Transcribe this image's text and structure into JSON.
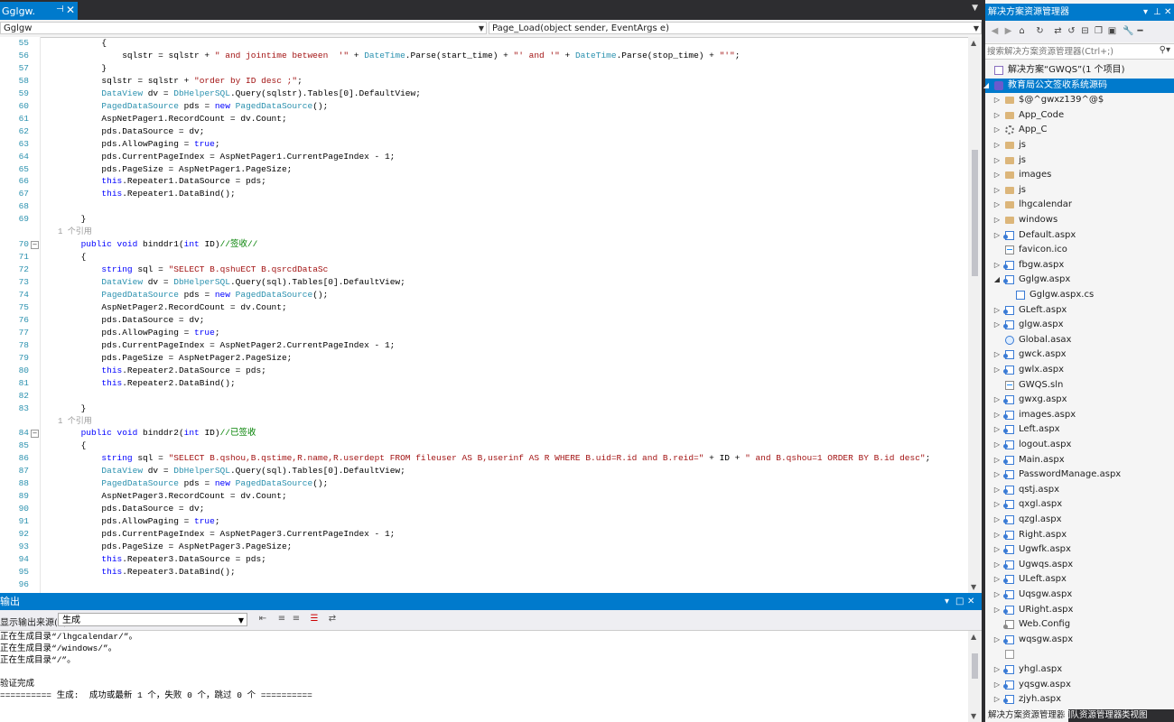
{
  "editor": {
    "tab": {
      "title": "Gglgw.",
      "pin": "⊣",
      "close": "✕"
    },
    "nav": {
      "left": "Gglgw",
      "right": "Page_Load(object sender, EventArgs e)"
    },
    "lines": [
      {
        "n": "55",
        "segs": [
          [
            "            {",
            ""
          ]
        ]
      },
      {
        "n": "56",
        "segs": [
          [
            "                sqlstr = sqlstr + ",
            ""
          ],
          [
            "\" and jointime between  '\"",
            "s"
          ],
          [
            " + ",
            ""
          ],
          [
            "DateTime",
            "ty"
          ],
          [
            ".Parse(start_time) + ",
            ""
          ],
          [
            "\"' and '\"",
            "s"
          ],
          [
            " + ",
            ""
          ],
          [
            "DateTime",
            "ty"
          ],
          [
            ".Parse(stop_time) + ",
            ""
          ],
          [
            "\"'\"",
            "s"
          ],
          [
            ";",
            ""
          ]
        ]
      },
      {
        "n": "57",
        "segs": [
          [
            "            }",
            ""
          ]
        ]
      },
      {
        "n": "58",
        "segs": [
          [
            "            sqlstr = sqlstr + ",
            ""
          ],
          [
            "\"order by ID desc ;\"",
            "s"
          ],
          [
            ";",
            ""
          ]
        ]
      },
      {
        "n": "59",
        "segs": [
          [
            "            ",
            ""
          ],
          [
            "DataView",
            "ty"
          ],
          [
            " dv = ",
            ""
          ],
          [
            "DbHelperSQL",
            "ty"
          ],
          [
            ".Query(sqlstr).Tables[0].DefaultView;",
            ""
          ]
        ]
      },
      {
        "n": "60",
        "segs": [
          [
            "            ",
            ""
          ],
          [
            "PagedDataSource",
            "ty"
          ],
          [
            " pds = ",
            ""
          ],
          [
            "new",
            "k"
          ],
          [
            " ",
            ""
          ],
          [
            "PagedDataSource",
            "ty"
          ],
          [
            "();",
            ""
          ]
        ]
      },
      {
        "n": "61",
        "segs": [
          [
            "            AspNetPager1.RecordCount = dv.Count;",
            ""
          ]
        ]
      },
      {
        "n": "62",
        "segs": [
          [
            "            pds.DataSource = dv;",
            ""
          ]
        ]
      },
      {
        "n": "63",
        "segs": [
          [
            "            pds.AllowPaging = ",
            ""
          ],
          [
            "true",
            "k"
          ],
          [
            ";",
            ""
          ]
        ]
      },
      {
        "n": "64",
        "segs": [
          [
            "            pds.CurrentPageIndex = AspNetPager1.CurrentPageIndex - 1;",
            ""
          ]
        ]
      },
      {
        "n": "65",
        "segs": [
          [
            "            pds.PageSize = AspNetPager1.PageSize;",
            ""
          ]
        ]
      },
      {
        "n": "66",
        "segs": [
          [
            "            ",
            ""
          ],
          [
            "this",
            "k"
          ],
          [
            ".Repeater1.DataSource = pds;",
            ""
          ]
        ]
      },
      {
        "n": "67",
        "segs": [
          [
            "            ",
            ""
          ],
          [
            "this",
            "k"
          ],
          [
            ".Repeater1.DataBind();",
            ""
          ]
        ]
      },
      {
        "n": "68",
        "segs": [
          [
            "",
            ""
          ]
        ]
      },
      {
        "n": "69",
        "segs": [
          [
            "        }",
            ""
          ]
        ],
        "ref": "1 个引用"
      },
      {
        "n": "70",
        "fold": true,
        "segs": [
          [
            "        ",
            ""
          ],
          [
            "public",
            "k"
          ],
          [
            " ",
            ""
          ],
          [
            "void",
            "k"
          ],
          [
            " binddr1(",
            ""
          ],
          [
            "int",
            "k"
          ],
          [
            " ID)",
            ""
          ],
          [
            "//签收//",
            "c"
          ]
        ]
      },
      {
        "n": "71",
        "segs": [
          [
            "        {",
            ""
          ]
        ]
      },
      {
        "n": "72",
        "segs": [
          [
            "            ",
            ""
          ],
          [
            "string",
            "k"
          ],
          [
            " sql = ",
            ""
          ],
          [
            "\"SELECT B.qshuECT B.qsrcdDataSc",
            "s"
          ]
        ]
      },
      {
        "n": "73",
        "segs": [
          [
            "            ",
            ""
          ],
          [
            "DataView",
            "ty"
          ],
          [
            " dv = ",
            ""
          ],
          [
            "DbHelperSQL",
            "ty"
          ],
          [
            ".Query(sql).Tables[0].DefaultView;",
            ""
          ]
        ]
      },
      {
        "n": "74",
        "segs": [
          [
            "            ",
            ""
          ],
          [
            "PagedDataSource",
            "ty"
          ],
          [
            " pds = ",
            ""
          ],
          [
            "new",
            "k"
          ],
          [
            " ",
            ""
          ],
          [
            "PagedDataSource",
            "ty"
          ],
          [
            "();",
            ""
          ]
        ]
      },
      {
        "n": "75",
        "segs": [
          [
            "            AspNetPager2.RecordCount = dv.Count;",
            ""
          ]
        ]
      },
      {
        "n": "76",
        "segs": [
          [
            "            pds.DataSource = dv;",
            ""
          ]
        ]
      },
      {
        "n": "77",
        "segs": [
          [
            "            pds.AllowPaging = ",
            ""
          ],
          [
            "true",
            "k"
          ],
          [
            ";",
            ""
          ]
        ]
      },
      {
        "n": "78",
        "segs": [
          [
            "            pds.CurrentPageIndex = AspNetPager2.CurrentPageIndex - 1;",
            ""
          ]
        ]
      },
      {
        "n": "79",
        "segs": [
          [
            "            pds.PageSize = AspNetPager2.PageSize;",
            ""
          ]
        ]
      },
      {
        "n": "80",
        "segs": [
          [
            "            ",
            ""
          ],
          [
            "this",
            "k"
          ],
          [
            ".Repeater2.DataSource = pds;",
            ""
          ]
        ]
      },
      {
        "n": "81",
        "segs": [
          [
            "            ",
            ""
          ],
          [
            "this",
            "k"
          ],
          [
            ".Repeater2.DataBind();",
            ""
          ]
        ]
      },
      {
        "n": "82",
        "segs": [
          [
            "",
            ""
          ]
        ]
      },
      {
        "n": "83",
        "segs": [
          [
            "        }",
            ""
          ]
        ],
        "ref": "1 个引用"
      },
      {
        "n": "84",
        "fold": true,
        "segs": [
          [
            "        ",
            ""
          ],
          [
            "public",
            "k"
          ],
          [
            " ",
            ""
          ],
          [
            "void",
            "k"
          ],
          [
            " binddr2(",
            ""
          ],
          [
            "int",
            "k"
          ],
          [
            " ID)",
            ""
          ],
          [
            "//已签收",
            "c"
          ]
        ]
      },
      {
        "n": "85",
        "segs": [
          [
            "        {",
            ""
          ]
        ]
      },
      {
        "n": "86",
        "segs": [
          [
            "            ",
            ""
          ],
          [
            "string",
            "k"
          ],
          [
            " sql = ",
            ""
          ],
          [
            "\"SELECT B.qshou,B.qstime,R.name,R.userdept FROM fileuser AS B,userinf AS R WHERE B.uid=R.id and B.reid=\"",
            "s"
          ],
          [
            " + ID + ",
            ""
          ],
          [
            "\" and B.qshou=1 ORDER BY B.id desc\"",
            "s"
          ],
          [
            ";",
            ""
          ]
        ]
      },
      {
        "n": "87",
        "segs": [
          [
            "            ",
            ""
          ],
          [
            "DataView",
            "ty"
          ],
          [
            " dv = ",
            ""
          ],
          [
            "DbHelperSQL",
            "ty"
          ],
          [
            ".Query(sql).Tables[0].DefaultView;",
            ""
          ]
        ]
      },
      {
        "n": "88",
        "segs": [
          [
            "            ",
            ""
          ],
          [
            "PagedDataSource",
            "ty"
          ],
          [
            " pds = ",
            ""
          ],
          [
            "new",
            "k"
          ],
          [
            " ",
            ""
          ],
          [
            "PagedDataSource",
            "ty"
          ],
          [
            "();",
            ""
          ]
        ]
      },
      {
        "n": "89",
        "segs": [
          [
            "            AspNetPager3.RecordCount = dv.Count;",
            ""
          ]
        ]
      },
      {
        "n": "90",
        "segs": [
          [
            "            pds.DataSource = dv;",
            ""
          ]
        ]
      },
      {
        "n": "91",
        "segs": [
          [
            "            pds.AllowPaging = ",
            ""
          ],
          [
            "true",
            "k"
          ],
          [
            ";",
            ""
          ]
        ]
      },
      {
        "n": "92",
        "segs": [
          [
            "            pds.CurrentPageIndex = AspNetPager3.CurrentPageIndex - 1;",
            ""
          ]
        ]
      },
      {
        "n": "93",
        "segs": [
          [
            "            pds.PageSize = AspNetPager3.PageSize;",
            ""
          ]
        ]
      },
      {
        "n": "94",
        "segs": [
          [
            "            ",
            ""
          ],
          [
            "this",
            "k"
          ],
          [
            ".Repeater3.DataSource = pds;",
            ""
          ]
        ]
      },
      {
        "n": "95",
        "segs": [
          [
            "            ",
            ""
          ],
          [
            "this",
            "k"
          ],
          [
            ".Repeater3.DataBind();",
            ""
          ]
        ]
      },
      {
        "n": "96",
        "segs": [
          [
            "",
            ""
          ]
        ]
      }
    ]
  },
  "output": {
    "title": "输出",
    "source_label": "显示输出来源(S):",
    "source_value": "生成",
    "lines": [
      "正在生成目录“/lhgcalendar/”。",
      "正在生成目录“/windows/”。",
      "正在生成目录“/”。",
      "",
      "验证完成",
      "========== 生成:  成功或最新 1 个，失败 0 个，跳过 0 个 =========="
    ]
  },
  "solution_explorer": {
    "title": "解决方案资源管理器",
    "search_placeholder": "搜索解决方案资源管理器(Ctrl+;)",
    "items": [
      {
        "label": "解决方案“GWQS”(1 个项目)",
        "level": 0,
        "icon": "sln",
        "exp": ""
      },
      {
        "label": "教育局公文签收系统源码",
        "level": 0,
        "icon": "proj",
        "exp": "◢",
        "selected": true
      },
      {
        "label": "$@^gwxz139^@$",
        "level": 1,
        "icon": "folder",
        "exp": "▷"
      },
      {
        "label": "App_Code",
        "level": 1,
        "icon": "folder",
        "exp": "▷"
      },
      {
        "label": "App_C",
        "level": 1,
        "icon": "gear",
        "exp": "▷"
      },
      {
        "label": "js",
        "level": 1,
        "icon": "folder",
        "exp": "▷"
      },
      {
        "label": "js",
        "level": 1,
        "icon": "folder",
        "exp": "▷"
      },
      {
        "label": "images",
        "level": 1,
        "icon": "folder",
        "exp": "▷"
      },
      {
        "label": "js",
        "level": 1,
        "icon": "folder",
        "exp": "▷"
      },
      {
        "label": "lhgcalendar",
        "level": 1,
        "icon": "folder",
        "exp": "▷"
      },
      {
        "label": "windows",
        "level": 1,
        "icon": "folder",
        "exp": "▷"
      },
      {
        "label": "Default.aspx",
        "level": 1,
        "icon": "aspx",
        "exp": "▷"
      },
      {
        "label": "favicon.ico",
        "level": 1,
        "icon": "page",
        "exp": ""
      },
      {
        "label": "fbgw.aspx",
        "level": 1,
        "icon": "aspx",
        "exp": "▷"
      },
      {
        "label": "Gglgw.aspx",
        "level": 1,
        "icon": "aspx",
        "exp": "◢"
      },
      {
        "label": "Gglgw.aspx.cs",
        "level": 2,
        "icon": "cs",
        "exp": ""
      },
      {
        "label": "GLeft.aspx",
        "level": 1,
        "icon": "aspx",
        "exp": "▷"
      },
      {
        "label": "glgw.aspx",
        "level": 1,
        "icon": "aspx",
        "exp": "▷"
      },
      {
        "label": "Global.asax",
        "level": 1,
        "icon": "globe",
        "exp": ""
      },
      {
        "label": "gwck.aspx",
        "level": 1,
        "icon": "aspx",
        "exp": "▷"
      },
      {
        "label": "gwlx.aspx",
        "level": 1,
        "icon": "aspx",
        "exp": "▷"
      },
      {
        "label": "GWQS.sln",
        "level": 1,
        "icon": "page",
        "exp": ""
      },
      {
        "label": "gwxg.aspx",
        "level": 1,
        "icon": "aspx",
        "exp": "▷"
      },
      {
        "label": "images.aspx",
        "level": 1,
        "icon": "aspx",
        "exp": "▷"
      },
      {
        "label": "Left.aspx",
        "level": 1,
        "icon": "aspx",
        "exp": "▷"
      },
      {
        "label": "logout.aspx",
        "level": 1,
        "icon": "aspx",
        "exp": "▷"
      },
      {
        "label": "Main.aspx",
        "level": 1,
        "icon": "aspx",
        "exp": "▷"
      },
      {
        "label": "PasswordManage.aspx",
        "level": 1,
        "icon": "aspx",
        "exp": "▷"
      },
      {
        "label": "qstj.aspx",
        "level": 1,
        "icon": "aspx",
        "exp": "▷"
      },
      {
        "label": "qxgl.aspx",
        "level": 1,
        "icon": "aspx",
        "exp": "▷"
      },
      {
        "label": "qzgl.aspx",
        "level": 1,
        "icon": "aspx",
        "exp": "▷"
      },
      {
        "label": "Right.aspx",
        "level": 1,
        "icon": "aspx",
        "exp": "▷"
      },
      {
        "label": "Ugwfk.aspx",
        "level": 1,
        "icon": "aspx",
        "exp": "▷"
      },
      {
        "label": "Ugwqs.aspx",
        "level": 1,
        "icon": "aspx",
        "exp": "▷"
      },
      {
        "label": "ULeft.aspx",
        "level": 1,
        "icon": "aspx",
        "exp": "▷"
      },
      {
        "label": "Uqsgw.aspx",
        "level": 1,
        "icon": "aspx",
        "exp": "▷"
      },
      {
        "label": "URight.aspx",
        "level": 1,
        "icon": "aspx",
        "exp": "▷"
      },
      {
        "label": "Web.Config",
        "level": 1,
        "icon": "cfg",
        "exp": ""
      },
      {
        "label": "wqsgw.aspx",
        "level": 1,
        "icon": "aspx",
        "exp": "▷"
      },
      {
        "label": "",
        "level": 1,
        "icon": "blank",
        "exp": ""
      },
      {
        "label": "yhgl.aspx",
        "level": 1,
        "icon": "aspx",
        "exp": "▷"
      },
      {
        "label": "yqsgw.aspx",
        "level": 1,
        "icon": "aspx",
        "exp": "▷"
      },
      {
        "label": "zjyh.aspx",
        "level": 1,
        "icon": "aspx",
        "exp": "▷"
      }
    ],
    "bottom_tabs": [
      "解决方案资源管理器",
      "团队资源管理器",
      "类视图"
    ]
  },
  "colors": {
    "accent": "#007acc",
    "keyword": "#0000ff",
    "type": "#2b91af",
    "string": "#a31515",
    "comment": "#008000"
  }
}
